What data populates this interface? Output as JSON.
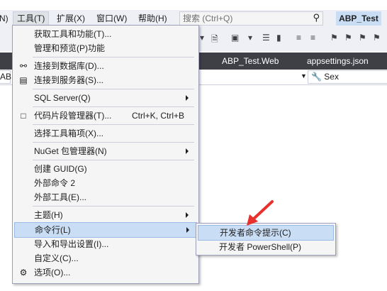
{
  "menubar": {
    "items": [
      {
        "label": "N)"
      },
      {
        "label": "工具(T)"
      },
      {
        "label": "扩展(X)"
      },
      {
        "label": "窗口(W)"
      },
      {
        "label": "帮助(H)"
      }
    ],
    "search_placeholder": "搜索 (Ctrl+Q)",
    "solution_name": "ABP_Test"
  },
  "doc_tabs": [
    "ABP_Test.Web",
    "appsettings.json"
  ],
  "nav": {
    "left_combo": "ABF",
    "right_combo": "Sex"
  },
  "tools_menu": {
    "items": [
      {
        "label": "获取工具和功能(T)..."
      },
      {
        "label": "管理和预览(P)功能"
      },
      {
        "label": "连接到数据库(D)..."
      },
      {
        "label": "连接到服务器(S)..."
      },
      {
        "label": "SQL Server(Q)"
      },
      {
        "label": "代码片段管理器(T)...",
        "shortcut": "Ctrl+K, Ctrl+B"
      },
      {
        "label": "选择工具箱项(X)..."
      },
      {
        "label": "NuGet 包管理器(N)"
      },
      {
        "label": "创建 GUID(G)"
      },
      {
        "label": "外部命令 2"
      },
      {
        "label": "外部工具(E)..."
      },
      {
        "label": "主题(H)"
      },
      {
        "label": "命令行(L)"
      },
      {
        "label": "导入和导出设置(I)..."
      },
      {
        "label": "自定义(C)..."
      },
      {
        "label": "选项(O)..."
      }
    ]
  },
  "submenu": {
    "items": [
      {
        "label": "开发者命令提示(C)"
      },
      {
        "label": "开发者 PowerShell(P)"
      }
    ]
  },
  "colors": {
    "highlight": "#c9def5",
    "annotation_arrow": "#e8302c"
  }
}
